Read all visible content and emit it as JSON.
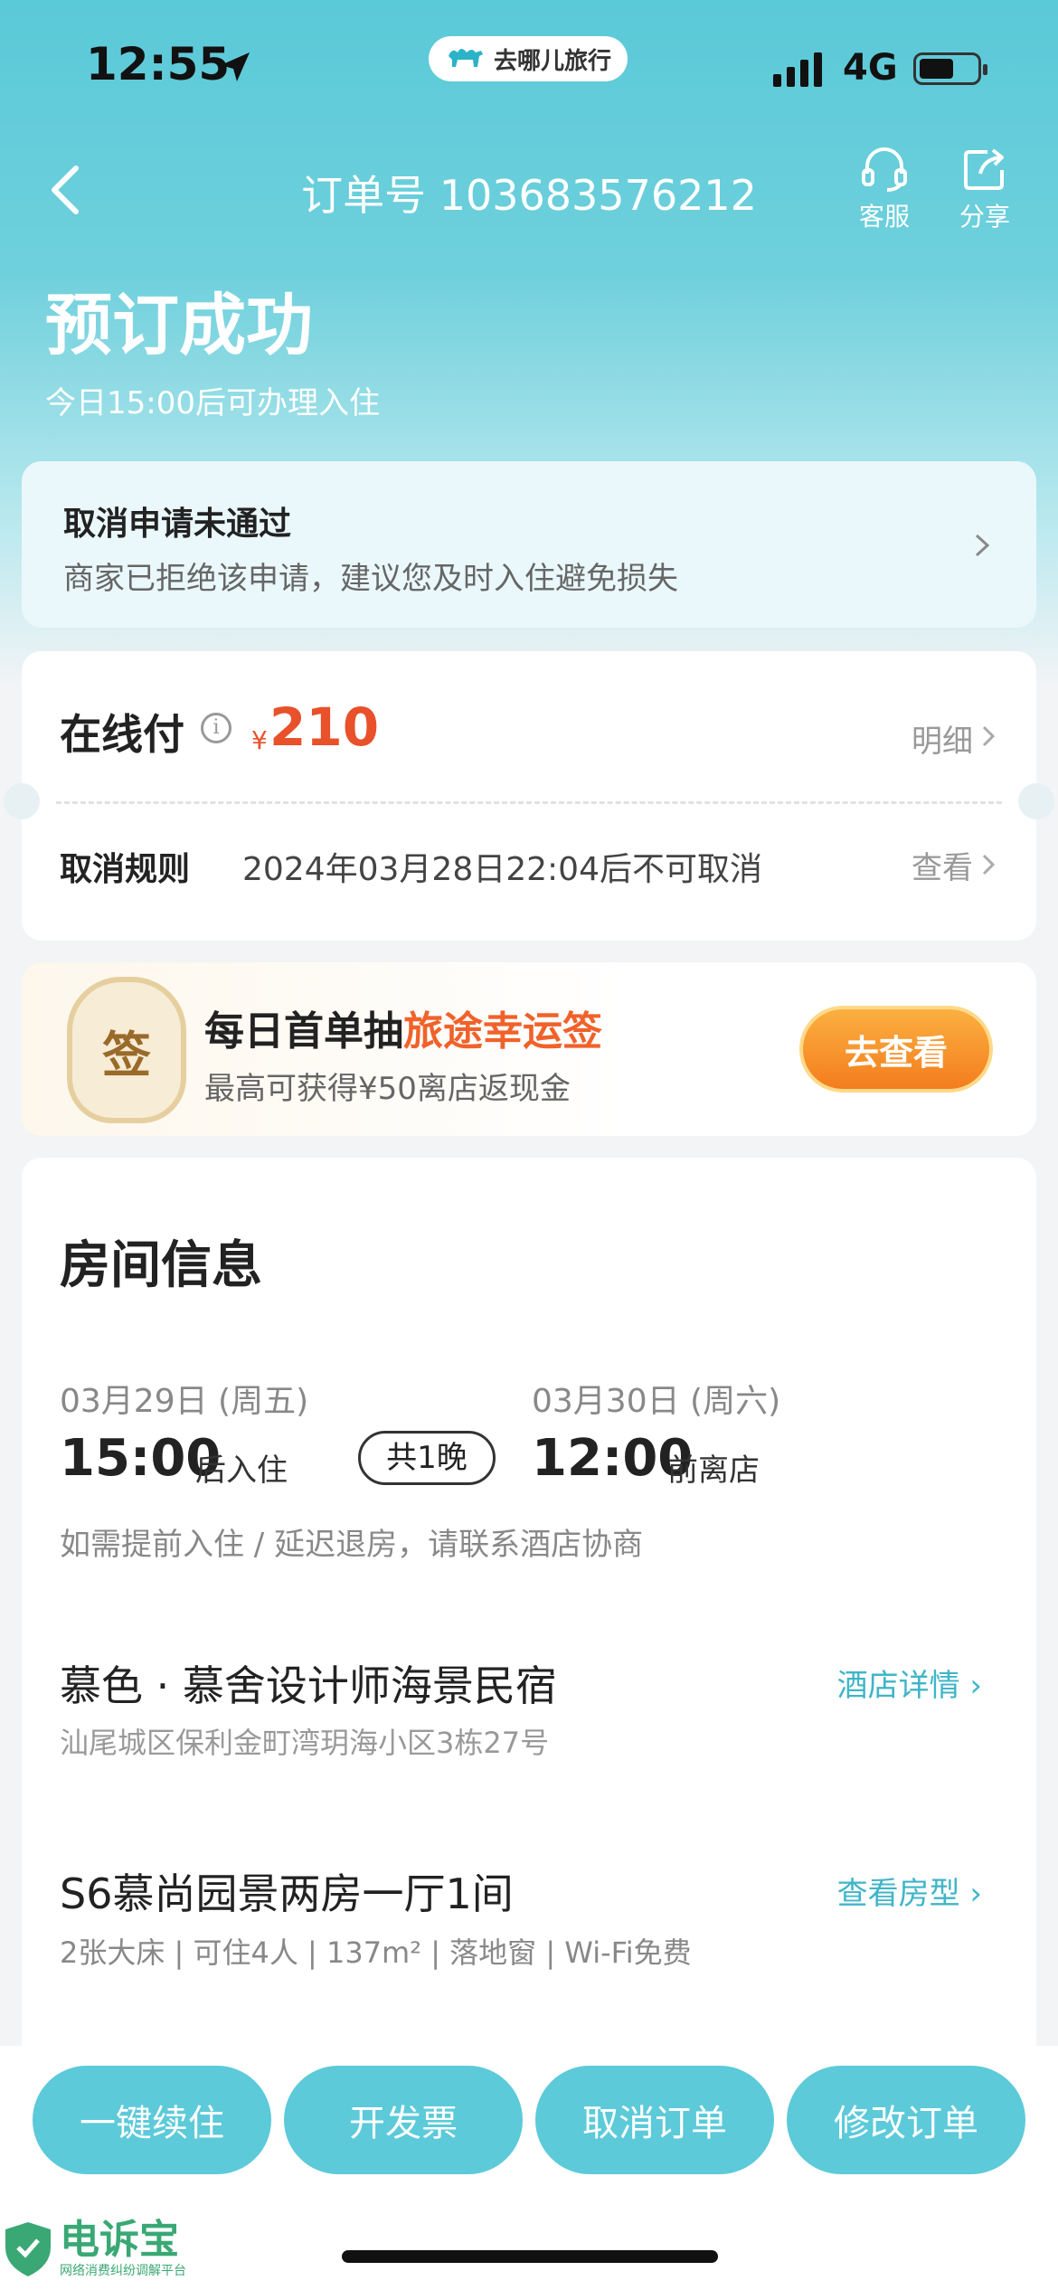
{
  "status_bar": {
    "time": "12:55",
    "brand": "去哪儿旅行",
    "network": "4G"
  },
  "nav": {
    "order_number": "订单号 103683576212",
    "service_label": "客服",
    "share_label": "分享"
  },
  "header": {
    "title": "预订成功",
    "subtitle": "今日15:00后可办理入住"
  },
  "cancel_notice": {
    "title": "取消申请未通过",
    "desc": "商家已拒绝该申请，建议您及时入住避免损失"
  },
  "payment": {
    "label": "在线付",
    "currency": "¥",
    "amount": "210",
    "detail_link": "明细",
    "rule_label": "取消规则",
    "rule_text": "2024年03月28日22:04后不可取消",
    "view_link": "查看"
  },
  "promo": {
    "badge": "签",
    "title_prefix": "每日首单抽",
    "title_highlight": "旅途幸运签",
    "subtitle": "最高可获得¥50离店返现金",
    "button": "去查看"
  },
  "room": {
    "heading": "房间信息",
    "checkin_date": "03月29日 (周五)",
    "checkin_time": "15:00",
    "checkin_suffix": "后入住",
    "nights": "共1晚",
    "checkout_date": "03月30日 (周六)",
    "checkout_time": "12:00",
    "checkout_suffix": "前离店",
    "early_note": "如需提前入住 / 延迟退房，请联系酒店协商",
    "hotel_name": "慕色 · 慕舍设计师海景民宿",
    "hotel_address": "汕尾城区保利金町湾玥海小区3栋27号",
    "hotel_link": "酒店详情",
    "room_name": "S6慕尚园景两房一厅1间",
    "room_attrs": "2张大床 | 可住4人 | 137m² | 落地窗 | Wi-Fi免费",
    "room_link": "查看房型"
  },
  "actions": {
    "renew": "一键续住",
    "invoice": "开发票",
    "cancel": "取消订单",
    "modify": "修改订单"
  },
  "watermark": {
    "title": "电诉宝",
    "subtitle": "网络消费纠纷调解平台"
  }
}
